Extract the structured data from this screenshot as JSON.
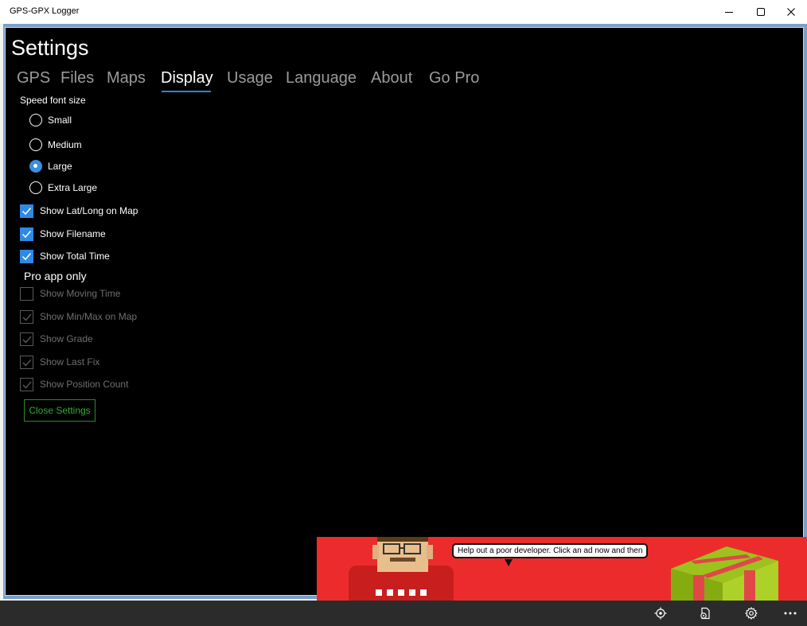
{
  "window": {
    "title": "GPS-GPX Logger"
  },
  "settings": {
    "title": "Settings",
    "tabs": [
      {
        "label": "GPS"
      },
      {
        "label": "Files"
      },
      {
        "label": "Maps"
      },
      {
        "label": "Display",
        "active": true
      },
      {
        "label": "Usage"
      },
      {
        "label": "Language"
      },
      {
        "label": "About"
      },
      {
        "label": "Go Pro"
      }
    ],
    "speed_font_size": {
      "label": "Speed font size",
      "options": [
        "Small",
        "Medium",
        "Large",
        "Extra Large"
      ],
      "selected": "Large"
    },
    "options": [
      {
        "label": "Show Lat/Long on Map",
        "checked": true
      },
      {
        "label": "Show Filename",
        "checked": true
      },
      {
        "label": "Show Total Time",
        "checked": true
      }
    ],
    "pro_label": "Pro app only",
    "pro_options": [
      {
        "label": "Show Moving Time",
        "checked": false
      },
      {
        "label": "Show Min/Max on Map",
        "checked": true
      },
      {
        "label": "Show Grade",
        "checked": true
      },
      {
        "label": "Show Last Fix",
        "checked": true
      },
      {
        "label": "Show Position Count",
        "checked": true
      }
    ],
    "close_button": "Close Settings"
  },
  "ad": {
    "message": "Help out a poor developer.  Click an ad now and then"
  },
  "appbar": {
    "icons": [
      "location-target-icon",
      "save-file-icon",
      "gear-icon",
      "more-icon"
    ]
  },
  "colors": {
    "accent": "#2f8ae6",
    "close_button": "#2fae2f",
    "ad_background": "#ec2c2c"
  }
}
